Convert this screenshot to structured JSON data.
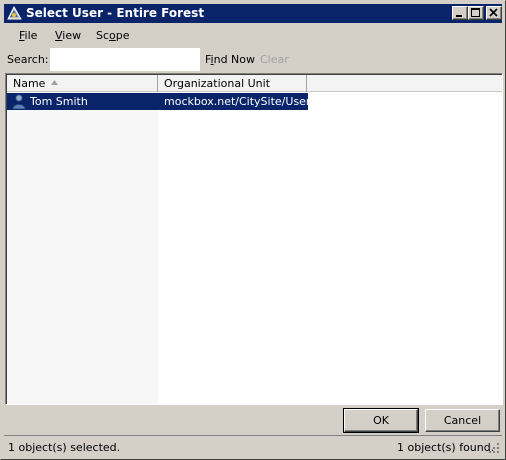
{
  "window": {
    "title": "Select User - Entire Forest",
    "icon": "directory-search-icon",
    "controls": [
      "minimize-icon",
      "maximize-icon",
      "close-icon"
    ]
  },
  "menu": {
    "items": [
      {
        "label": "File",
        "mnemonic": "F",
        "rest": "ile"
      },
      {
        "label": "View",
        "mnemonic": "V",
        "rest": "iew"
      },
      {
        "label": "Scope",
        "pre": "Sc",
        "mnemonic": "o",
        "rest": "pe"
      }
    ]
  },
  "search": {
    "label": "Search:",
    "value": "",
    "find_now": {
      "pre": "F",
      "mnemonic": "i",
      "rest": "nd Now"
    },
    "clear": "Clear"
  },
  "list": {
    "columns": [
      "Name",
      "Organizational Unit"
    ],
    "sort_column": "Name",
    "sort_direction": "ascending",
    "rows": [
      {
        "name": "Tom Smith",
        "ou": "mockbox.net/CitySite/Users",
        "icon": "user-icon",
        "selected": true
      }
    ]
  },
  "buttons": {
    "ok": "OK",
    "cancel": "Cancel"
  },
  "status": {
    "selected": "1 object(s) selected.",
    "found": "1 object(s) found."
  },
  "colors": {
    "titlebar": "#0a246a",
    "selection": "#0a246a",
    "face": "#d4d0c8"
  }
}
